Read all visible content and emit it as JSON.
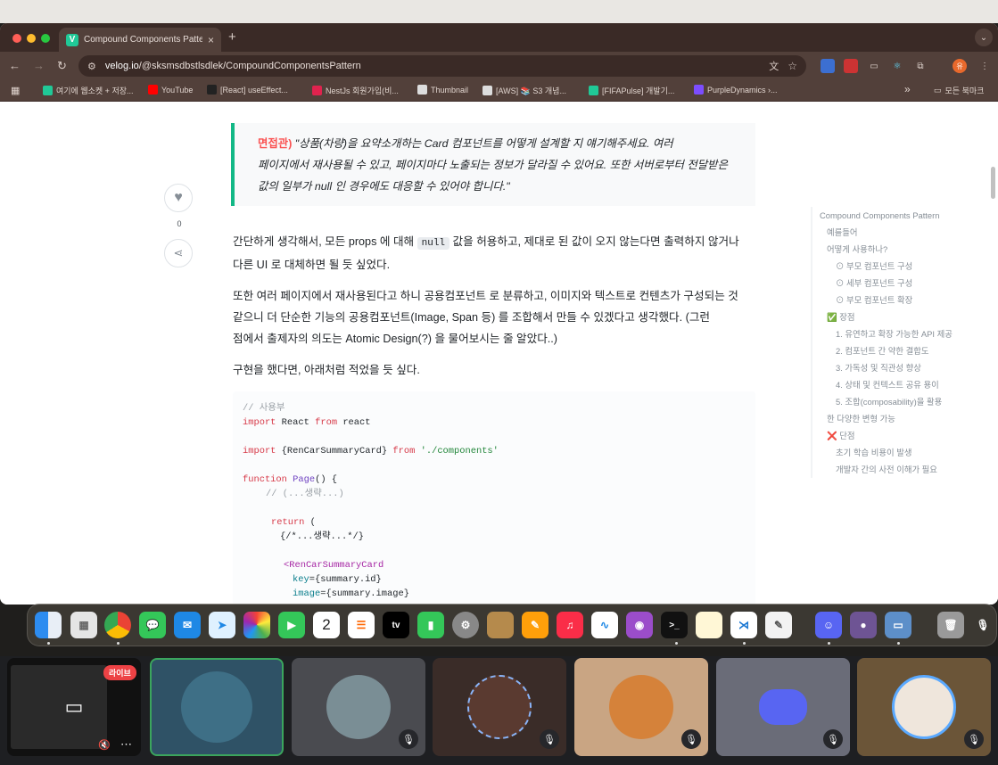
{
  "browser": {
    "tab_title": "Compound Components Patte",
    "tab_close": "×",
    "new_tab": "+",
    "tab_menu": "⌄",
    "url_host": "velog.io",
    "url_path": "/@sksmsdbstlsdlek/CompoundComponentsPattern",
    "profile_initial": "유"
  },
  "bookmarks": [
    {
      "label": "여기에 웹소켓 + 저장...",
      "color": "#20c997"
    },
    {
      "label": "YouTube",
      "color": "#ff0000"
    },
    {
      "label": "[React] useEffect...",
      "color": "#222222"
    },
    {
      "label": "NestJs 회원가입(비...",
      "color": "#e0234e"
    },
    {
      "label": "Thumbnail",
      "color": "#dddddd"
    },
    {
      "label": "[AWS] 📚 S3 개념...",
      "color": "#dddddd"
    },
    {
      "label": "[FIFAPulse] 개발기...",
      "color": "#20c997"
    },
    {
      "label": "PurpleDynamics ›...",
      "color": "#7c4dff"
    }
  ],
  "bookmarks_more": "»",
  "bookmarks_all": "모든 북마크",
  "article": {
    "quote_label": "면접관)",
    "quote_text_1": " \"상품(차량)을 요약소개하는 Card 컴포넌트를 어떻게 설계할 지 얘기해주세요. 여러",
    "quote_text_2": "페이지에서 재사용될 수 있고, 페이지마다 노출되는 정보가 달라질 수 있어요. 또한 서버로부터 전달받은",
    "quote_text_3": "값의 일부가 null 인 경우에도 대응할 수 있어야 합니다.\"",
    "like_count": "0",
    "p1_a": "간단하게 생각해서, 모든 props 에 대해 ",
    "p1_code": "null",
    "p1_b": " 값을 허용하고, 제대로 된 값이 오지 않는다면 출력하지 않거나",
    "p1_c": "다른 UI 로 대체하면 될 듯 싶었다.",
    "p2_1": "또한 여러 페이지에서 재사용된다고 하니 공용컴포넌트 로 분류하고, 이미지와 텍스트로 컨텐츠가 구성되는 것",
    "p2_2": "같으니 더 단순한 기능의 공용컴포넌트(Image, Span 등) 를 조합해서 만들 수 있겠다고 생각했다. (그런",
    "p2_3": "점에서 출제자의 의도는 Atomic Design(?) 을 물어보시는 줄 알았다..)",
    "p3": "구현을 했다면, 아래처럼 적었을 듯 싶다."
  },
  "code": {
    "c1": "// 사용부",
    "import": "import",
    "from": "from",
    "react": "React",
    "react_pkg": "react",
    "card_import": "{RenCarSummaryCard}",
    "path": "'./components'",
    "function": "function",
    "page": "Page",
    "page_sig": "() {",
    "c2": "// (...생략...)",
    "return": "return",
    "paren": "(",
    "c3": "{/*...생략...*/}",
    "tag": "<RenCarSummaryCard",
    "key_attr": "key",
    "key_val": "={summary.id}",
    "img_attr": "image",
    "img_val": "={summary.image}"
  },
  "toc": [
    {
      "label": "Compound Components Pattern",
      "level": 0
    },
    {
      "label": "예를들어",
      "level": 1
    },
    {
      "label": "어떻게 사용하나?",
      "level": 1
    },
    {
      "label": "⊙ 부모 컴포넌트 구성",
      "level": 2
    },
    {
      "label": "⊙ 세부 컴포넌트 구성",
      "level": 2
    },
    {
      "label": "⊙ 부모 컴포넌트 확장",
      "level": 2
    },
    {
      "label": "✅ 장점",
      "level": 1
    },
    {
      "label": "1. 유연하고 확장 가능한 API 제공",
      "level": 2
    },
    {
      "label": "2. 컴포넌트 간 약한 결합도",
      "level": 2
    },
    {
      "label": "3. 가독성 및 직관성 향상",
      "level": 2
    },
    {
      "label": "4. 상태 및 컨텍스트 공유 용이",
      "level": 2
    },
    {
      "label": "5. 조합(composability)을 활용",
      "level": 2
    },
    {
      "label": "한 다양한 변형 가능",
      "level": 1
    },
    {
      "label": "❌ 단점",
      "level": 1
    },
    {
      "label": "초기 학습 비용이 발생",
      "level": 2
    },
    {
      "label": "개발자 간의 사전 이해가 필요",
      "level": 2
    }
  ],
  "dock": {
    "calendar_day": "2",
    "tv_label": "tv"
  },
  "call": {
    "live_badge": "라이브"
  }
}
